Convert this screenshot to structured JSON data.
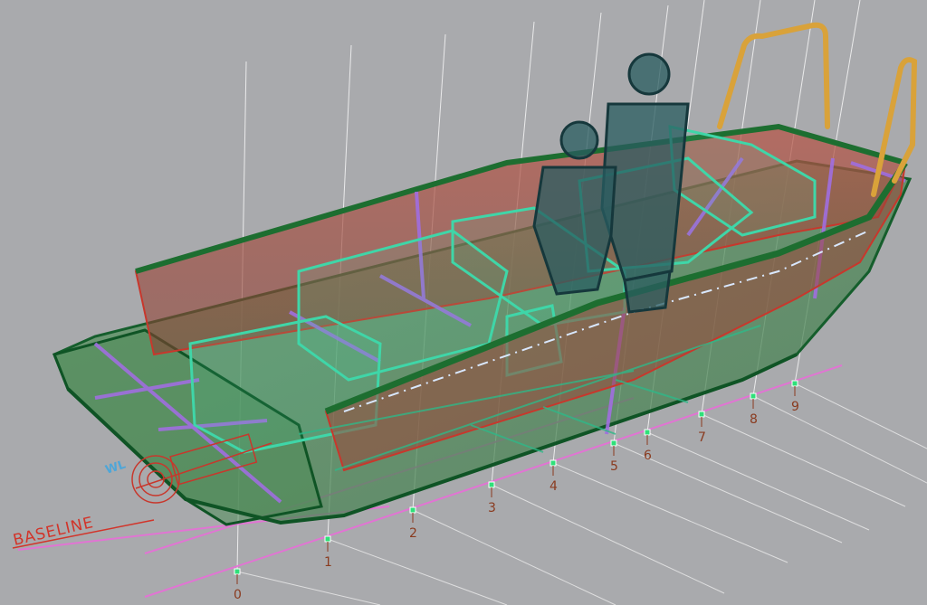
{
  "viewport": {
    "description_free": true,
    "background_color": "#a9aaad"
  },
  "labels": {
    "baseline": "BASELINE",
    "waterline_tag": "WL"
  },
  "stations": [
    "0",
    "1",
    "2",
    "3",
    "4",
    "5",
    "6",
    "7",
    "8",
    "9"
  ],
  "colors": {
    "hull_green": "#1f7a3a",
    "hull_fill": "#3e7f4a",
    "sheer_red": "#c8372c",
    "bulkhead_teal": "#3fd6a8",
    "frame_purple": "#9a5fd6",
    "seat_dark": "#1f4d52",
    "rail_orange": "#d9a23a",
    "grid_magenta": "#e86fd8",
    "station_dot": "#2fe07a"
  },
  "icons": {
    "station_marker": "station-marker-icon",
    "seat": "seat-icon",
    "propeller": "propeller-icon"
  }
}
